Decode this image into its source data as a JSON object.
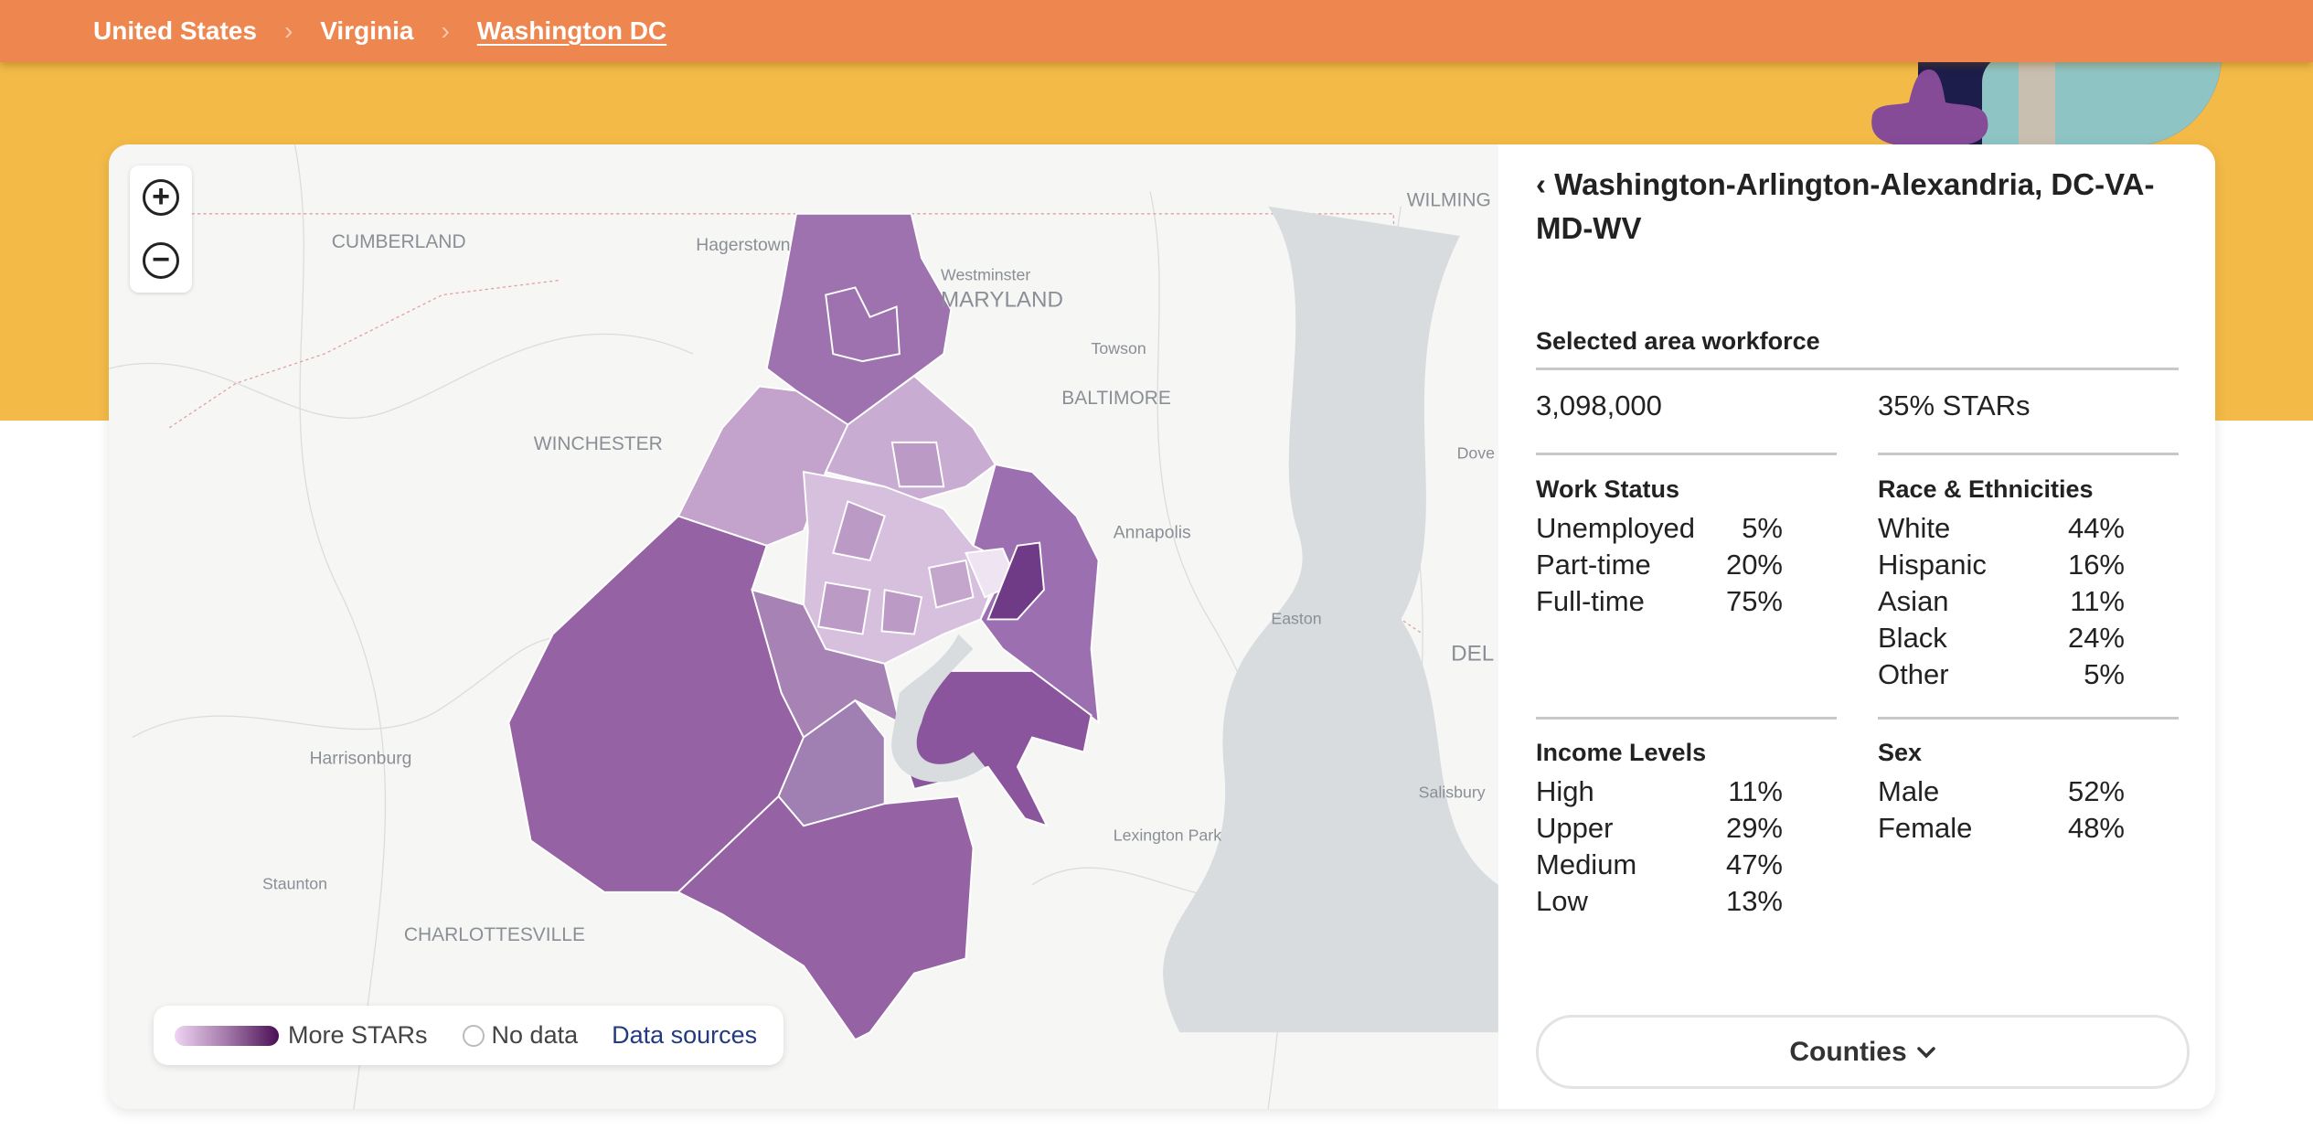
{
  "breadcrumb": [
    "United States",
    "Virginia",
    "Washington DC"
  ],
  "map": {
    "zoom_in": "+",
    "zoom_out": "−",
    "labels": {
      "cumberland": "CUMBERLAND",
      "hagerstown": "Hagerstown",
      "westminster": "Westminster",
      "maryland": "MARYLAND",
      "towson": "Towson",
      "baltimore": "BALTIMORE",
      "winchester": "WINCHESTER",
      "annapolis": "Annapolis",
      "dover": "Dove",
      "easton": "Easton",
      "del": "DEL",
      "harrisonburg": "Harrisonburg",
      "salisbury": "Salisbury",
      "lexington_park": "Lexington Park",
      "staunton": "Staunton",
      "charlottesville": "CHARLOTTESVILLE",
      "wilmington": "WILMING"
    },
    "legend": {
      "more": "More STARs",
      "no_data": "No data",
      "sources": "Data sources"
    },
    "colors": {
      "low": "#efd4f2",
      "high": "#4a0f55"
    }
  },
  "panel": {
    "back_icon": "‹",
    "title": "Washington-Arlington-Alexandria, DC-VA-MD-WV",
    "selected_label": "Selected area workforce",
    "workforce": "3,098,000",
    "stars": "35% STARs",
    "work_status": {
      "title": "Work Status",
      "rows": [
        {
          "l": "Unemployed",
          "v": "5%"
        },
        {
          "l": "Part-time",
          "v": "20%"
        },
        {
          "l": "Full-time",
          "v": "75%"
        }
      ]
    },
    "race": {
      "title": "Race & Ethnicities",
      "rows": [
        {
          "l": "White",
          "v": "44%"
        },
        {
          "l": "Hispanic",
          "v": "16%"
        },
        {
          "l": "Asian",
          "v": "11%"
        },
        {
          "l": "Black",
          "v": "24%"
        },
        {
          "l": "Other",
          "v": "5%"
        }
      ]
    },
    "income": {
      "title": "Income Levels",
      "rows": [
        {
          "l": "High",
          "v": "11%"
        },
        {
          "l": "Upper",
          "v": "29%"
        },
        {
          "l": "Medium",
          "v": "47%"
        },
        {
          "l": "Low",
          "v": "13%"
        }
      ]
    },
    "sex": {
      "title": "Sex",
      "rows": [
        {
          "l": "Male",
          "v": "52%"
        },
        {
          "l": "Female",
          "v": "48%"
        }
      ]
    },
    "counties_button": "Counties"
  }
}
